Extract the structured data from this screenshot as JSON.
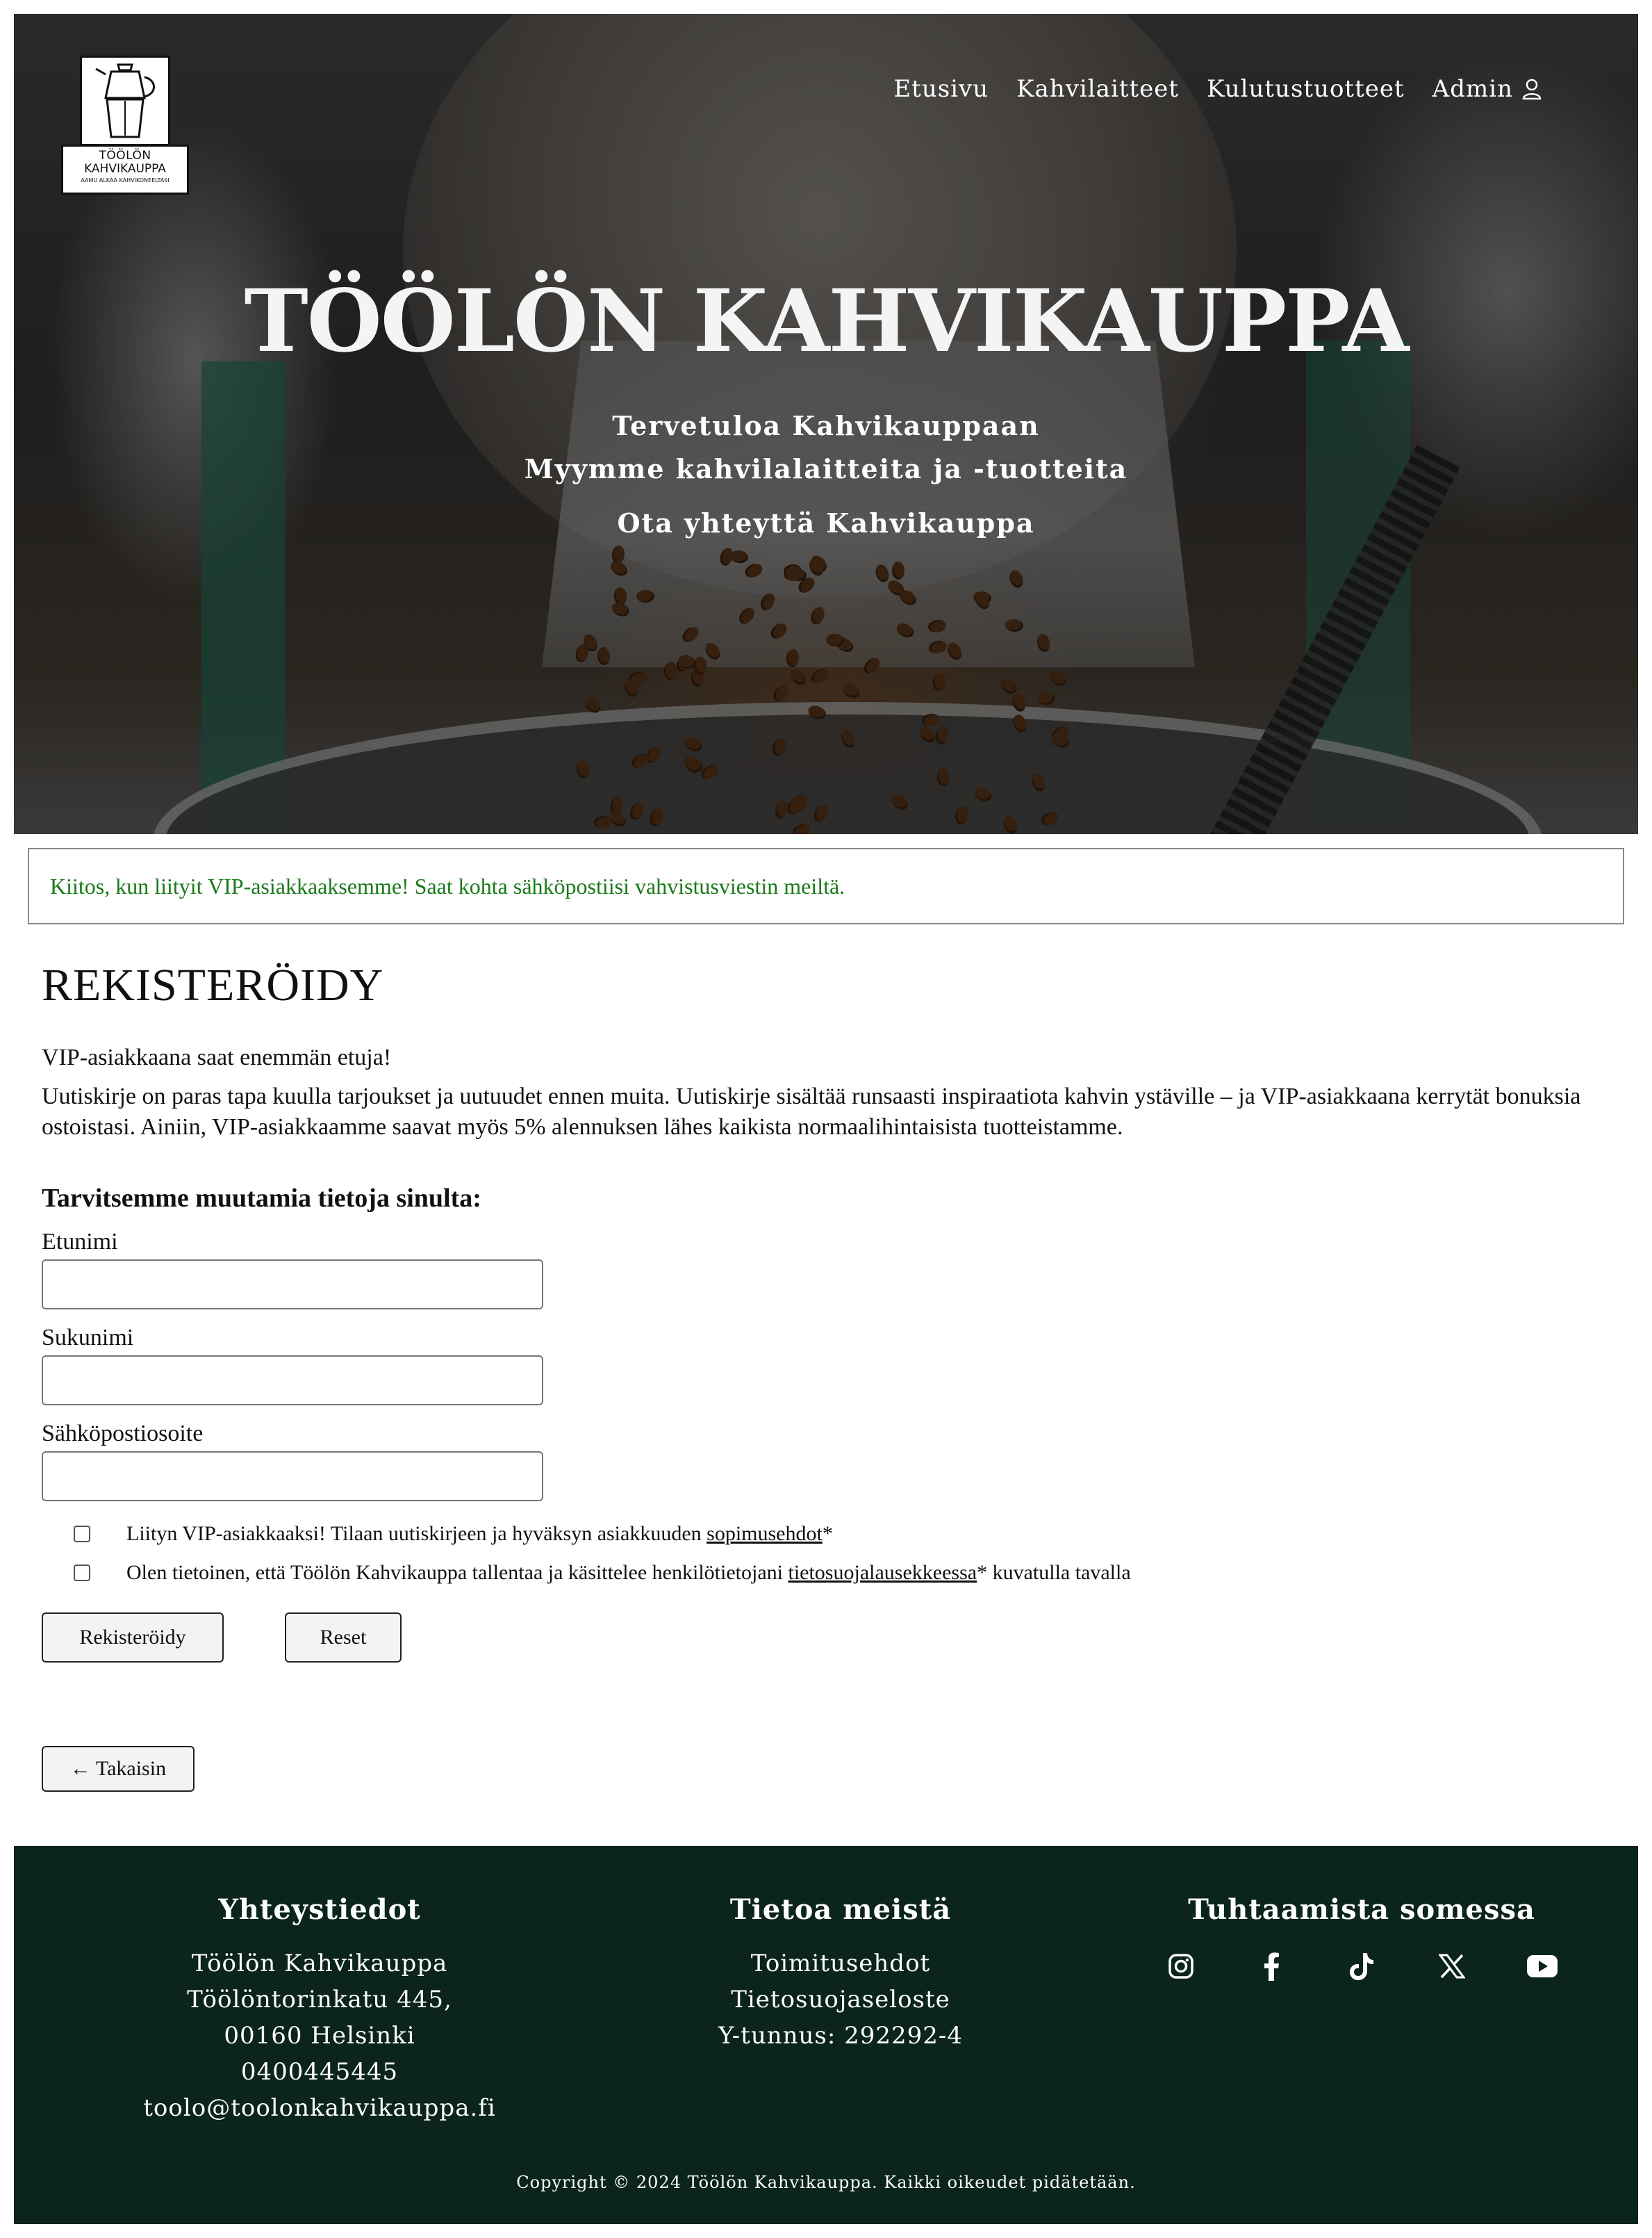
{
  "logo": {
    "line1": "TÖÖLÖN",
    "line2": "KAHVIKAUPPA",
    "tagline": "AAMU ALKAA KAHVIKONEELTASI"
  },
  "nav": {
    "items": [
      "Etusivu",
      "Kahvilaitteet",
      "Kulutustuotteet",
      "Admin"
    ],
    "admin_icon": "user-icon"
  },
  "hero": {
    "title": "TÖÖLÖN KAHVIKAUPPA",
    "sub1": "Tervetuloa Kahvikauppaan",
    "sub2": "Myymme kahvilalaitteita ja -tuotteita",
    "sub3": "Ota yhteyttä Kahvikauppa"
  },
  "alert": {
    "message": "Kiitos, kun liityit VIP-asiakkaaksemme! Saat kohta sähköpostiisi vahvistusviestin meiltä.",
    "color": "#1b7a1b"
  },
  "register": {
    "title": "REKISTERÖIDY",
    "intro1": "VIP-asiakkaana saat enemmän etuja!",
    "intro2": "Uutiskirje on paras tapa kuulla tarjoukset ja uutuudet ennen muita. Uutiskirje sisältää runsaasti inspiraatiota kahvin ystäville – ja VIP-asiakkaana kerrytät bonuksia ostoistasi. Ainiin, VIP-asiakkaamme saavat myös 5% alennuksen lähes kaikista normaalihintaisista tuotteistamme.",
    "form_heading": "Tarvitsemme muutamia tietoja sinulta:",
    "fields": {
      "firstname_label": "Etunimi",
      "firstname_value": "",
      "lastname_label": "Sukunimi",
      "lastname_value": "",
      "email_label": "Sähköpostiosoite",
      "email_value": ""
    },
    "checkbox1": {
      "text_before": "Liityn VIP-asiakkaaksi! Tilaan uutiskirjeen ja hyväksyn asiakkuuden ",
      "link": "sopimusehdot",
      "text_after": "*",
      "checked": false
    },
    "checkbox2": {
      "text_before": "Olen tietoinen, että Töölön Kahvikauppa tallentaa ja käsittelee henkilötietojani ",
      "link": "tietosuojalausekkeessa",
      "text_after": "* kuvatulla tavalla",
      "checked": false
    },
    "submit_label": "Rekisteröidy",
    "reset_label": "Reset",
    "back_label": "← Takaisin"
  },
  "footer": {
    "contact": {
      "title": "Yhteystiedot",
      "name": "Töölön Kahvikauppa",
      "street": "Töölöntorinkatu 445,",
      "city": "00160 Helsinki",
      "phone": "0400445445",
      "email": "toolo@toolonkahvikauppa.fi"
    },
    "about": {
      "title": "Tietoa meistä",
      "terms": "Toimitusehdot",
      "privacy": "Tietosuojaseloste",
      "business_id": "Y-tunnus: 292292-4"
    },
    "social": {
      "title": "Tuhtaamista somessa",
      "icons": [
        "instagram-icon",
        "facebook-icon",
        "tiktok-icon",
        "x-icon",
        "youtube-icon"
      ]
    },
    "copyright": "Copyright © 2024 Töölön Kahvikauppa. Kaikki oikeudet pidätetään.",
    "bg_color": "#0b241d"
  }
}
